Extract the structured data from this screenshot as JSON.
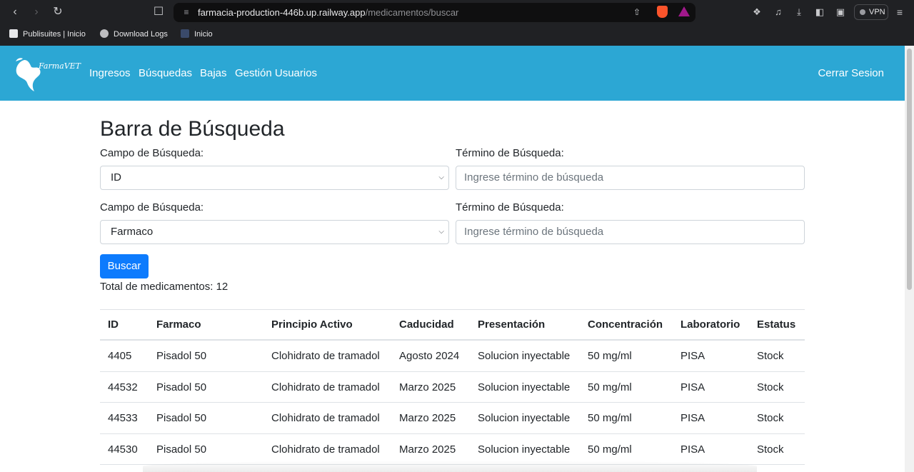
{
  "browser": {
    "url_host": "farmacia-production-446b.up.railway.app",
    "url_path": "/medicamentos/buscar",
    "vpn_label": "VPN",
    "bookmarks": [
      {
        "label": "Publisuites | Inicio",
        "icon": "publisuites-icon"
      },
      {
        "label": "Download Logs",
        "icon": "globe-icon"
      },
      {
        "label": "Inicio",
        "icon": "site-favicon-icon"
      }
    ]
  },
  "navbar": {
    "brand": "FarmaVET",
    "links": [
      "Ingresos",
      "Búsquedas",
      "Bajas",
      "Gestión Usuarios"
    ],
    "logout": "Cerrar Sesion",
    "color": "#2ca7d4"
  },
  "search": {
    "title": "Barra de Búsqueda",
    "rows": [
      {
        "field_label": "Campo de Búsqueda:",
        "field_value": "ID",
        "term_label": "Término de Búsqueda:",
        "term_placeholder": "Ingrese término de búsqueda"
      },
      {
        "field_label": "Campo de Búsqueda:",
        "field_value": "Farmaco",
        "term_label": "Término de Búsqueda:",
        "term_placeholder": "Ingrese término de búsqueda"
      }
    ],
    "button": "Buscar",
    "button_color": "#0d7bfd",
    "total": "Total de medicamentos: 12"
  },
  "table": {
    "headers": [
      "ID",
      "Farmaco",
      "Principio Activo",
      "Caducidad",
      "Presentación",
      "Concentración",
      "Laboratorio",
      "Estatus"
    ],
    "rows": [
      [
        "4405",
        "Pisadol 50",
        "Clohidrato de tramadol",
        "Agosto 2024",
        "Solucion inyectable",
        "50 mg/ml",
        "PISA",
        "Stock"
      ],
      [
        "44532",
        "Pisadol 50",
        "Clohidrato de tramadol",
        "Marzo 2025",
        "Solucion inyectable",
        "50 mg/ml",
        "PISA",
        "Stock"
      ],
      [
        "44533",
        "Pisadol 50",
        "Clohidrato de tramadol",
        "Marzo 2025",
        "Solucion inyectable",
        "50 mg/ml",
        "PISA",
        "Stock"
      ],
      [
        "44530",
        "Pisadol 50",
        "Clohidrato de tramadol",
        "Marzo 2025",
        "Solucion inyectable",
        "50 mg/ml",
        "PISA",
        "Stock"
      ]
    ]
  }
}
